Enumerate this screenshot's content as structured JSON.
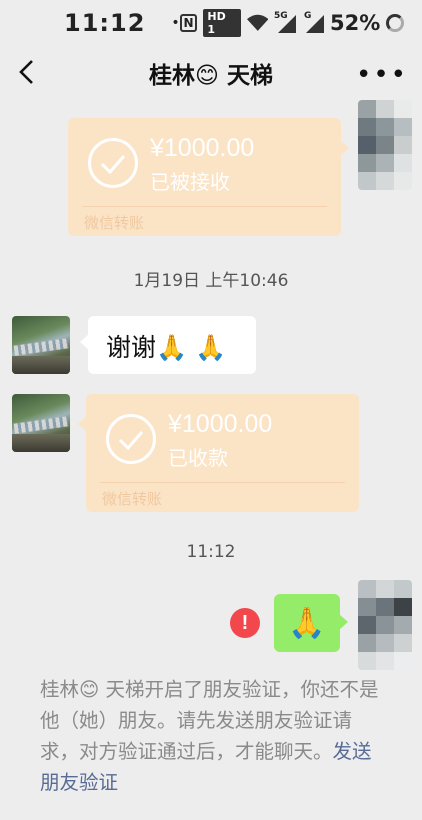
{
  "status_bar": {
    "time": "11:12",
    "dot": "•",
    "nfc": "N",
    "hd": "HD 1",
    "net_5g": "5G",
    "net_g": "G",
    "battery": "52%"
  },
  "nav": {
    "title": "桂林😊 天梯",
    "more": "•••"
  },
  "messages": {
    "transfer_sent": {
      "amount": "¥1000.00",
      "status": "已被接收",
      "label": "微信转账"
    },
    "timestamp_1": "1月19日 上午10:46",
    "thanks_text": "谢谢🙏 🙏",
    "transfer_received": {
      "amount": "¥1000.00",
      "status": "已收款",
      "label": "微信转账"
    },
    "timestamp_2": "11:12",
    "sent_emoji": "🙏",
    "error_mark": "!"
  },
  "system_notice": {
    "text": "桂林😊 天梯开启了朋友验证，你还不是他（她）朋友。请先发送朋友验证请求，对方验证通过后，才能聊天。",
    "link": "发送朋友验证"
  },
  "colors": {
    "background": "#ededed",
    "transfer_bg": "#fbe3c6",
    "green_bubble": "#95ec69",
    "error_red": "#f2484d",
    "link": "#576b95"
  }
}
